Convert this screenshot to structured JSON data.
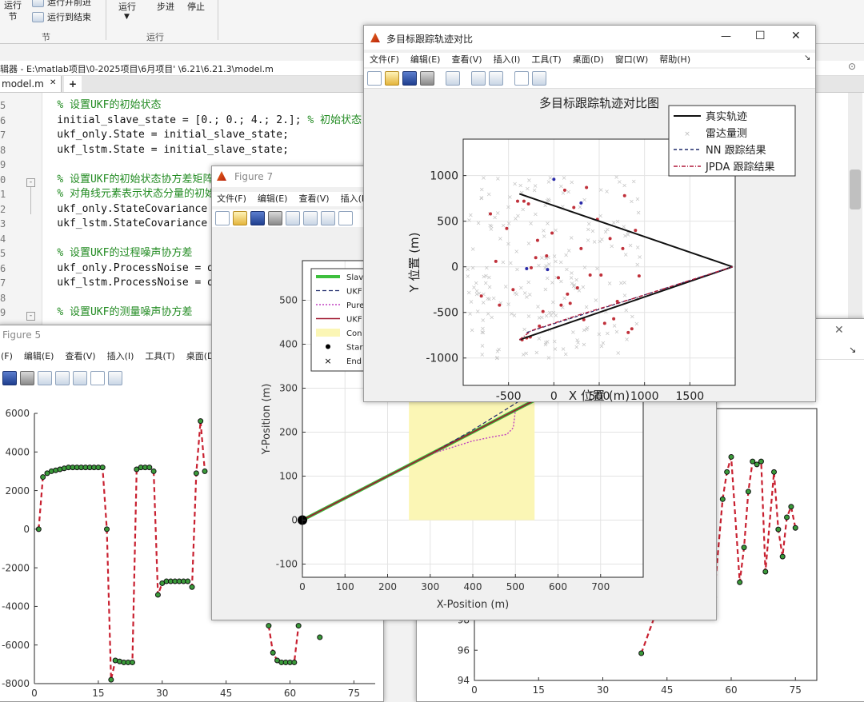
{
  "ribbon": {
    "run_section": "运行\n节",
    "run_advance": "运行并前进",
    "run_to_end": "运行到结束",
    "section_group": "节",
    "run": "运行",
    "step": "步进",
    "stop": "停止",
    "run_group": "运行"
  },
  "editor": {
    "title": "辑器 - E:\\matlab项目\\0-2025项目\\6月项目'  \\6.21\\6.21.3\\model.m",
    "tab": "model.m",
    "add_tab": "+",
    "line_numbers": [
      "5",
      "6",
      "7",
      "8",
      "9",
      "0",
      "1",
      "2",
      "3",
      "4",
      "5",
      "6",
      "7",
      "8",
      "9"
    ],
    "lines": [
      "    % 设置UKF的初始状态",
      "    initial_slave_state = [0.; 0.; 4.; 2.]; % 初始状态",
      "    ukf_only.State = initial_slave_state;",
      "    ukf_lstm.State = initial_slave_state;",
      "",
      "    % 设置UKF的初始状态协方差矩阵",
      "    % 对角线元素表示状态分量的初始",
      "    ukf_only.StateCovariance",
      "    ukf_lstm.StateCovariance",
      "",
      "    % 设置UKF的过程噪声协方差",
      "    ukf_only.ProcessNoise = d",
      "    ukf_lstm.ProcessNoise = d",
      "",
      "    % 设置UKF的测量噪声协方差"
    ]
  },
  "main_window": {
    "title": "多目标跟踪轨迹对比",
    "menu": [
      "文件(F)",
      "编辑(E)",
      "查看(V)",
      "插入(I)",
      "工具(T)",
      "桌面(D)",
      "窗口(W)",
      "帮助(H)"
    ],
    "minimize_glyph": "—",
    "maximize_glyph": "☐",
    "close_glyph": "✕",
    "dock_glyph": "↘"
  },
  "figure7": {
    "title": "Figure 7",
    "menu": [
      "文件(F)",
      "编辑(E)",
      "查看(V)",
      "插入(I"
    ]
  },
  "figure5": {
    "title": "Figure 5",
    "menu": [
      "(F)",
      "编辑(E)",
      "查看(V)",
      "插入(I)",
      "工具(T)",
      "桌面(D"
    ]
  },
  "figure_right": {
    "close_glyph": "✕"
  },
  "chart_data": [
    {
      "type": "scatter",
      "title": "多目标跟踪轨迹对比图",
      "xlabel": "X 位置 (m)",
      "ylabel": "Y 位置 (m)",
      "xlim": [
        -1000,
        2000
      ],
      "ylim": [
        -1300,
        1400
      ],
      "xticks": [
        "-500",
        "0",
        "500",
        "1000",
        "1500"
      ],
      "xtick_values": [
        -500,
        0,
        500,
        1000,
        1500
      ],
      "yticks": [
        "1000",
        "500",
        "0",
        "-500",
        "-1000"
      ],
      "ytick_values": [
        1000,
        500,
        0,
        -500,
        -1000
      ],
      "grid": true,
      "legend_position": "top-right",
      "legend": [
        "真实轨迹",
        "雷达量测",
        "NN 跟踪结果",
        "JPDA 跟踪结果"
      ],
      "true_tracks": [
        {
          "x": [
            -380,
            1970
          ],
          "y": [
            800,
            0
          ]
        },
        {
          "x": [
            -380,
            1970
          ],
          "y": [
            -800,
            0
          ]
        }
      ],
      "clutter_points": {
        "x_range": [
          -950,
          1000
        ],
        "y_range": [
          -1000,
          1000
        ],
        "count": 220
      },
      "red_measurements": {
        "x": [
          -800,
          -700,
          -640,
          -600,
          -520,
          -450,
          -400,
          -300,
          -250,
          -180,
          -120,
          -80,
          -20,
          50,
          120,
          180,
          220,
          260,
          300,
          360,
          400,
          480,
          560,
          620,
          700,
          780,
          820,
          860,
          900,
          940,
          -330,
          -350,
          -280,
          -260,
          -200,
          -160,
          80,
          150,
          330,
          520,
          660,
          760
        ],
        "y": [
          -320,
          580,
          60,
          -420,
          420,
          -250,
          720,
          -780,
          -10,
          290,
          -490,
          120,
          370,
          -120,
          840,
          -400,
          650,
          -230,
          200,
          870,
          -90,
          520,
          -620,
          310,
          -380,
          780,
          -720,
          -680,
          400,
          -100,
          720,
          -800,
          690,
          -770,
          100,
          -650,
          -420,
          -300,
          -580,
          -90,
          -570,
          200
        ]
      },
      "blue_measurements": {
        "x": [
          -300,
          -70,
          0,
          300
        ],
        "y": [
          -20,
          -30,
          960,
          700
        ]
      },
      "nn_track": {
        "x": [
          -300,
          1970
        ],
        "y": [
          -720,
          0
        ]
      },
      "jpda_track": {
        "x": [
          -380,
          -250,
          300,
          900,
          1970
        ],
        "y": [
          -800,
          -700,
          -520,
          -340,
          0
        ]
      }
    },
    {
      "type": "line",
      "title": "",
      "xlabel": "X-Position (m)",
      "ylabel": "Y-Position (m)",
      "xlim": [
        0,
        800
      ],
      "ylim": [
        -130,
        590
      ],
      "xticks": [
        "0",
        "100",
        "200",
        "300",
        "400",
        "500",
        "600",
        "700"
      ],
      "xtick_values": [
        0,
        100,
        200,
        300,
        400,
        500,
        600,
        700
      ],
      "yticks": [
        "500",
        "400",
        "300",
        "200",
        "100",
        "0",
        "-100"
      ],
      "ytick_values": [
        500,
        400,
        300,
        200,
        100,
        0,
        -100
      ],
      "grid": true,
      "legend_position": "top-left",
      "legend": [
        "Slav",
        "UKF",
        "Pure",
        "UKF",
        "Con",
        "Star",
        "End"
      ],
      "series": [
        {
          "name": "Slave",
          "x": [
            0,
            100,
            200,
            300,
            400,
            500,
            550
          ],
          "y": [
            0,
            50,
            100,
            150,
            200,
            250,
            275
          ]
        },
        {
          "name": "UKF-dashed",
          "x": [
            0,
            100,
            200,
            300,
            400,
            500,
            550
          ],
          "y": [
            0,
            50,
            100,
            150,
            205,
            265,
            300
          ]
        },
        {
          "name": "Pure",
          "x": [
            0,
            100,
            200,
            300,
            400,
            450,
            480,
            495,
            500,
            550
          ],
          "y": [
            0,
            50,
            100,
            150,
            180,
            190,
            195,
            210,
            250,
            275
          ]
        },
        {
          "name": "UKF-solid",
          "x": [
            0,
            100,
            200,
            300,
            400,
            500,
            550
          ],
          "y": [
            0,
            50,
            100,
            150,
            200,
            250,
            275
          ]
        }
      ],
      "region": {
        "x": [
          250,
          545
        ],
        "y": [
          0,
          300
        ]
      },
      "start": [
        0,
        0
      ]
    },
    {
      "type": "line",
      "title": "",
      "xlim": [
        0,
        80
      ],
      "ylim": [
        -8000,
        6000
      ],
      "xticks": [
        "0",
        "15",
        "30",
        "45",
        "60",
        "75"
      ],
      "xtick_values": [
        0,
        15,
        30,
        45,
        60,
        75
      ],
      "yticks": [
        "6000",
        "4000",
        "2000",
        "0",
        "-2000",
        "-4000",
        "-6000",
        "-8000"
      ],
      "ytick_values": [
        6000,
        4000,
        2000,
        0,
        -2000,
        -4000,
        -6000,
        -8000
      ],
      "grid": false,
      "x": [
        1,
        2,
        3,
        4,
        5,
        6,
        7,
        8,
        9,
        10,
        11,
        12,
        13,
        14,
        15,
        16,
        17,
        18,
        19,
        20,
        21,
        22,
        23,
        24,
        25,
        26,
        27,
        28,
        29,
        30,
        31,
        32,
        33,
        34,
        35,
        36,
        37,
        38,
        39,
        40,
        41,
        42,
        43,
        44,
        45,
        46,
        47,
        48,
        49,
        50,
        51,
        52,
        53,
        54,
        55,
        56,
        57,
        58,
        59,
        60,
        61,
        62,
        63,
        64,
        65,
        66,
        67
      ],
      "y": [
        0,
        2700,
        2900,
        3000,
        3050,
        3100,
        3150,
        3200,
        3200,
        3200,
        3200,
        3200,
        3200,
        3200,
        3200,
        3200,
        0,
        -7800,
        -6800,
        -6850,
        -6900,
        -6900,
        -6900,
        3100,
        3200,
        3200,
        3200,
        3000,
        -3400,
        -2800,
        -2700,
        -2700,
        -2700,
        -2700,
        -2700,
        -2700,
        -3000,
        2900,
        5600,
        3000,
        null,
        null,
        null,
        null,
        null,
        null,
        null,
        null,
        null,
        null,
        null,
        null,
        null,
        null,
        -5000,
        -6400,
        -6800,
        -6900,
        -6900,
        -6900,
        -6900,
        -5000,
        null,
        null,
        null,
        null,
        -5600
      ]
    },
    {
      "type": "line",
      "title": "",
      "xlim": [
        0,
        80
      ],
      "ylim": [
        94,
        112
      ],
      "xticks": [
        "0",
        "15",
        "30",
        "45",
        "60",
        "75"
      ],
      "xtick_values": [
        0,
        15,
        30,
        45,
        60,
        75
      ],
      "yticks": [
        "98",
        "96",
        "94"
      ],
      "ytick_values": [
        98,
        96,
        94
      ],
      "grid": false,
      "x": [
        39,
        45,
        46,
        48,
        49,
        50,
        51,
        53,
        54,
        56,
        58,
        59,
        60,
        62,
        63,
        64,
        65,
        66,
        67,
        68,
        70,
        71,
        72,
        73,
        74,
        75
      ],
      "y": [
        95.8,
        100.5,
        101.7,
        100.2,
        100,
        103,
        105,
        102.5,
        101.6,
        99.5,
        106,
        107.8,
        108.8,
        100.5,
        102.8,
        106.5,
        108.5,
        108.3,
        108.5,
        101.2,
        107.8,
        104,
        102.2,
        104.8,
        105.5,
        104.1
      ]
    }
  ]
}
